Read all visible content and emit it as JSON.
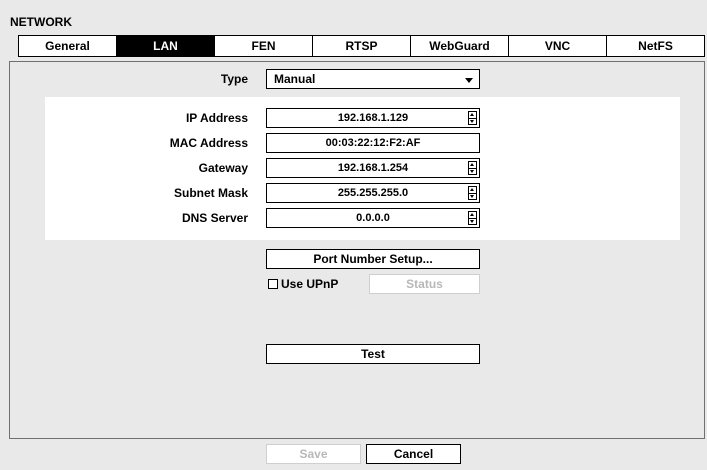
{
  "window": {
    "title": "NETWORK"
  },
  "tabs": [
    {
      "label": "General",
      "active": false
    },
    {
      "label": "LAN",
      "active": true
    },
    {
      "label": "FEN",
      "active": false
    },
    {
      "label": "RTSP",
      "active": false
    },
    {
      "label": "WebGuard",
      "active": false
    },
    {
      "label": "VNC",
      "active": false
    },
    {
      "label": "NetFS",
      "active": false
    }
  ],
  "type": {
    "label": "Type",
    "value": "Manual"
  },
  "fields": {
    "ip": {
      "label": "IP Address",
      "value": "192.168.1.129"
    },
    "mac": {
      "label": "MAC Address",
      "value": "00:03:22:12:F2:AF"
    },
    "gateway": {
      "label": "Gateway",
      "value": "192.168.1.254"
    },
    "subnet": {
      "label": "Subnet Mask",
      "value": "255.255.255.0"
    },
    "dns": {
      "label": "DNS Server",
      "value": "0.0.0.0"
    }
  },
  "buttons": {
    "port_setup": "Port Number Setup...",
    "use_upnp": "Use UPnP",
    "status": "Status",
    "test": "Test",
    "save": "Save",
    "cancel": "Cancel"
  }
}
